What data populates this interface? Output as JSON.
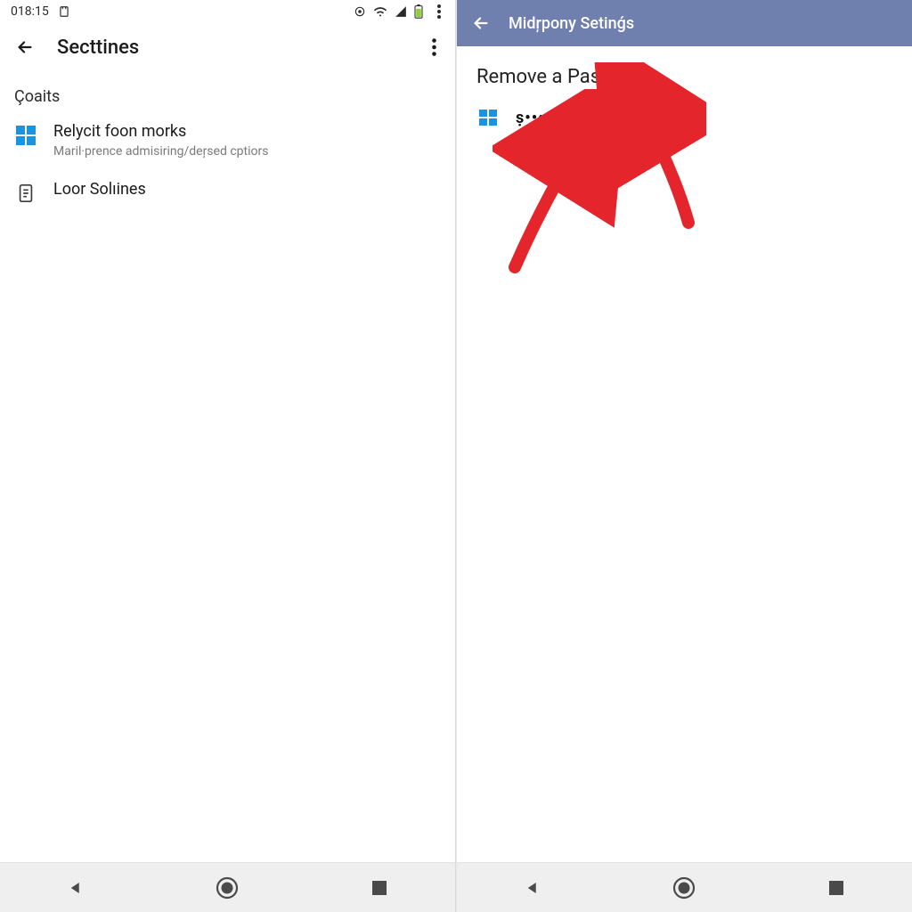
{
  "left": {
    "statusbar": {
      "time": "018:15"
    },
    "appbar": {
      "title": "Secttines"
    },
    "section_label": "Çoaits",
    "items": [
      {
        "title": "Relycit foon morks",
        "subtitle": "Maril·prence admisiring/deŗsed cptiors"
      },
      {
        "title": "Loor Solıines"
      }
    ]
  },
  "right": {
    "topbar": {
      "title": "Midŗpony Setinǵs"
    },
    "heading": "Remove a Password",
    "password_masked": "ṣ•••••••k"
  }
}
